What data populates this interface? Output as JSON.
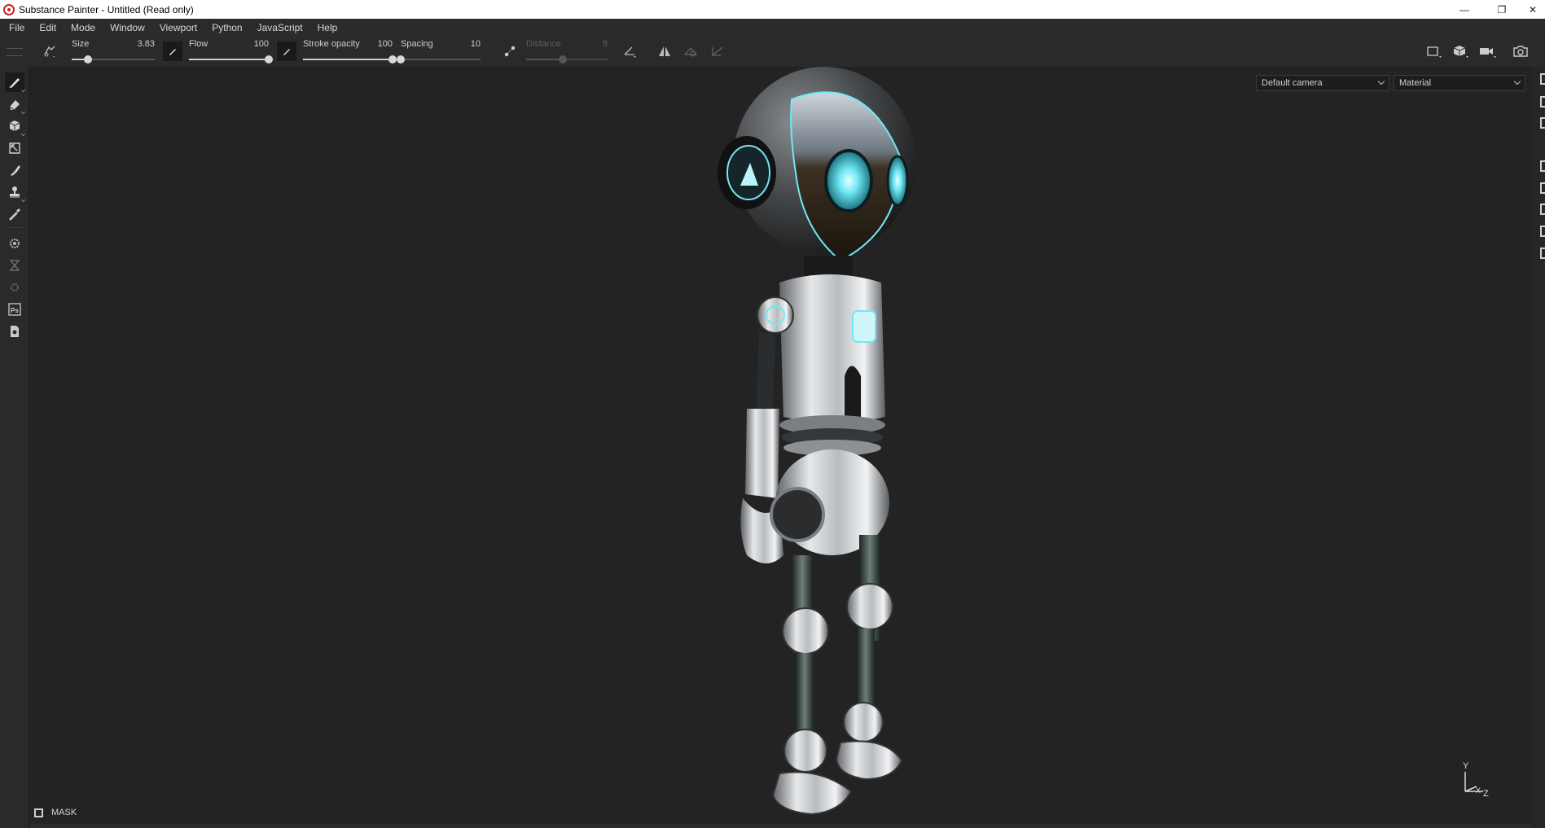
{
  "window": {
    "title": "Substance Painter - Untitled (Read only)",
    "minimize_glyph": "—",
    "restore_glyph": "❐",
    "close_glyph": "✕"
  },
  "menu": [
    "File",
    "Edit",
    "Mode",
    "Window",
    "Viewport",
    "Python",
    "JavaScript",
    "Help"
  ],
  "tool_options": {
    "size": {
      "label": "Size",
      "value": "3.83",
      "level": 0.2
    },
    "flow": {
      "label": "Flow",
      "value": "100",
      "level": 1.0
    },
    "stroke_opacity": {
      "label": "Stroke opacity",
      "value": "100",
      "level": 1.0
    },
    "spacing": {
      "label": "Spacing",
      "value": "10",
      "level": 0.0
    },
    "distance": {
      "label": "Distance",
      "value": "8",
      "level": 0.45,
      "disabled": true
    }
  },
  "left_tools": [
    "paint-brush",
    "eraser",
    "projection",
    "polygon-fill",
    "smudge",
    "clone-stamp",
    "color-picker",
    "settings",
    "bake",
    "geometry-mask",
    "photoshop-export",
    "document-export"
  ],
  "left_tool_labels": {
    "photoshop": "Ps"
  },
  "viewport": {
    "camera_select": "Default camera",
    "channel_select": "Material",
    "mask_label": "MASK",
    "gizmo": {
      "y": "Y",
      "x": "X",
      "z": "Z"
    }
  },
  "colors": {
    "background": "#232323",
    "panel": "#2a2a2a",
    "robot_glow": "#6fe9f5"
  }
}
